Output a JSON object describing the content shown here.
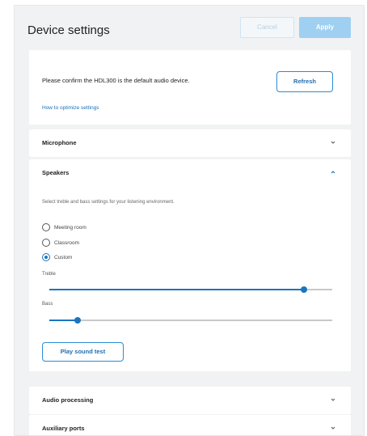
{
  "header": {
    "title": "Device settings",
    "cancel_label": "Cancel",
    "apply_label": "Apply"
  },
  "confirm": {
    "message": "Please confirm the HDL300 is the default audio device.",
    "link": "How to optimize settings",
    "refresh_label": "Refresh"
  },
  "sections": {
    "microphone": "Microphone",
    "speakers": "Speakers",
    "audio_processing": "Audio processing",
    "auxiliary_ports": "Auxiliary ports"
  },
  "speakers": {
    "description": "Select treble and bass settings for your listening environment.",
    "options": [
      {
        "label": "Meeting room",
        "selected": false
      },
      {
        "label": "Classroom",
        "selected": false
      },
      {
        "label": "Custom",
        "selected": true
      }
    ],
    "treble": {
      "label": "Treble",
      "level": 0.9
    },
    "bass": {
      "label": "Bass",
      "level": 0.1
    },
    "test_label": "Play sound test"
  },
  "colors": {
    "accent": "#1a75c1",
    "apply_bg": "#9fd0f2",
    "panel_bg": "#f1f2f3"
  },
  "icons": {
    "collapsed": "chevron-down-icon",
    "expanded": "chevron-up-icon"
  }
}
